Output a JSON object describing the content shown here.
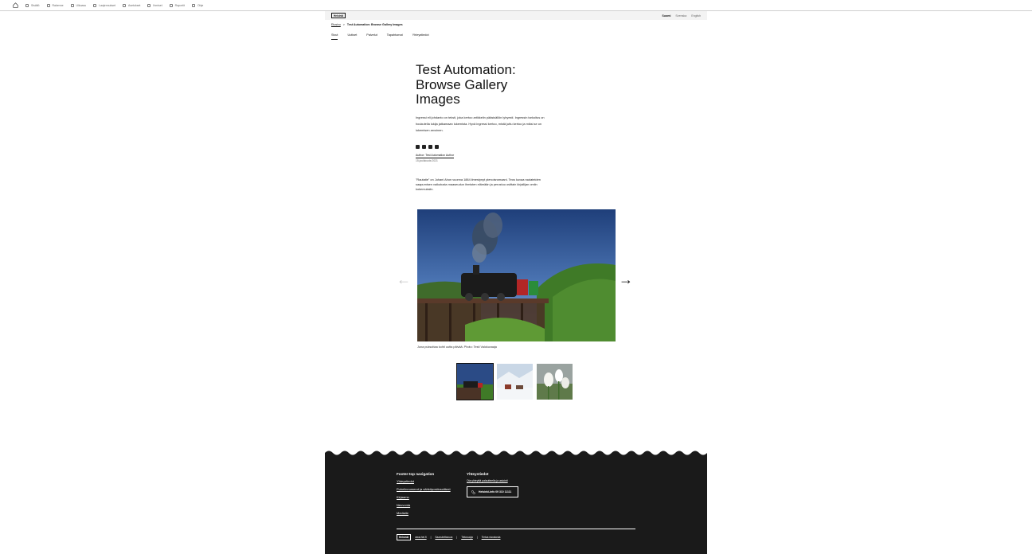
{
  "admin_toolbar": {
    "items": [
      {
        "label": "Sisältö",
        "icon": "content-icon"
      },
      {
        "label": "Rakenne",
        "icon": "structure-icon"
      },
      {
        "label": "Ulkoasu",
        "icon": "appearance-icon"
      },
      {
        "label": "Laajennukset",
        "icon": "extend-icon"
      },
      {
        "label": "Asetukset",
        "icon": "config-icon"
      },
      {
        "label": "Ihmiset",
        "icon": "people-icon"
      },
      {
        "label": "Raportit",
        "icon": "reports-icon"
      },
      {
        "label": "Ohje",
        "icon": "help-icon"
      }
    ]
  },
  "header": {
    "logo_text": "Helsinki",
    "languages": [
      "Suomi",
      "Svenska",
      "English"
    ],
    "active_language": "Suomi"
  },
  "breadcrumb": {
    "home": "Etusivu",
    "separator": ">",
    "current": "Test Automation: Browse Gallery Images"
  },
  "main_nav": {
    "items": [
      "Sivut",
      "Uutiset",
      "Palvelut",
      "Tapahtumat",
      "Yhteystiedot"
    ],
    "active": "Sivut"
  },
  "article": {
    "title": "Test Automation: Browse Gallery Images",
    "lead": "Ingressi eli johdanto on teksti, joka kertoo artikkelin pääsisällön lyhyesti. Ingressin tarkoitus on houkutella lukija jatkamaan lukemista. Hyvä ingressi kertoo, mistä juttu kertoo ja miksi se on lukemisen arvoinen.",
    "share_icons": [
      "facebook-icon",
      "linkedin-icon",
      "twitter-icon",
      "email-icon"
    ],
    "author": "Author: Test Automation Author",
    "date": "15.joulukuuta 2021",
    "body": "\"Rautatie\" on Juhani Ahon vuonna 1884 ilmestynyt pienoisromaani. Teos kuvaa rautateiden saapumisen vaikutusta maaseudun ihmisten elämään ja perustuu osittain kirjailijan omiin kokemuksiin."
  },
  "gallery": {
    "caption": "Juna puksuttaa kohti uutta päivää. Photo: Testi Valokuvaaja",
    "prev_icon": "arrow-left-icon",
    "next_icon": "arrow-right-icon",
    "thumbnails": [
      "Höyryjuna sillalla",
      "Luminen kylä",
      "Valkoiset tulppaanit"
    ],
    "active_index": 0
  },
  "footer": {
    "nav_heading": "Footer-top navigation",
    "nav_links": [
      "Yhteystiedot",
      "Puhelinnumerot ja sähköpostiosoitteet",
      "Kirjaamo",
      "Neuvonta",
      "Medialle"
    ],
    "contact_heading": "Yhteystiedot",
    "contact_link": "Ota yhteyttä palautteella ja asiointi",
    "phone_label": "Helsinki-info 09 310 11111",
    "logo_text": "Helsinki",
    "bottom_links": [
      "www.hel.fi",
      "Saavutettavuus",
      "Tietosuoja",
      "Tietoa sivustosta"
    ]
  }
}
